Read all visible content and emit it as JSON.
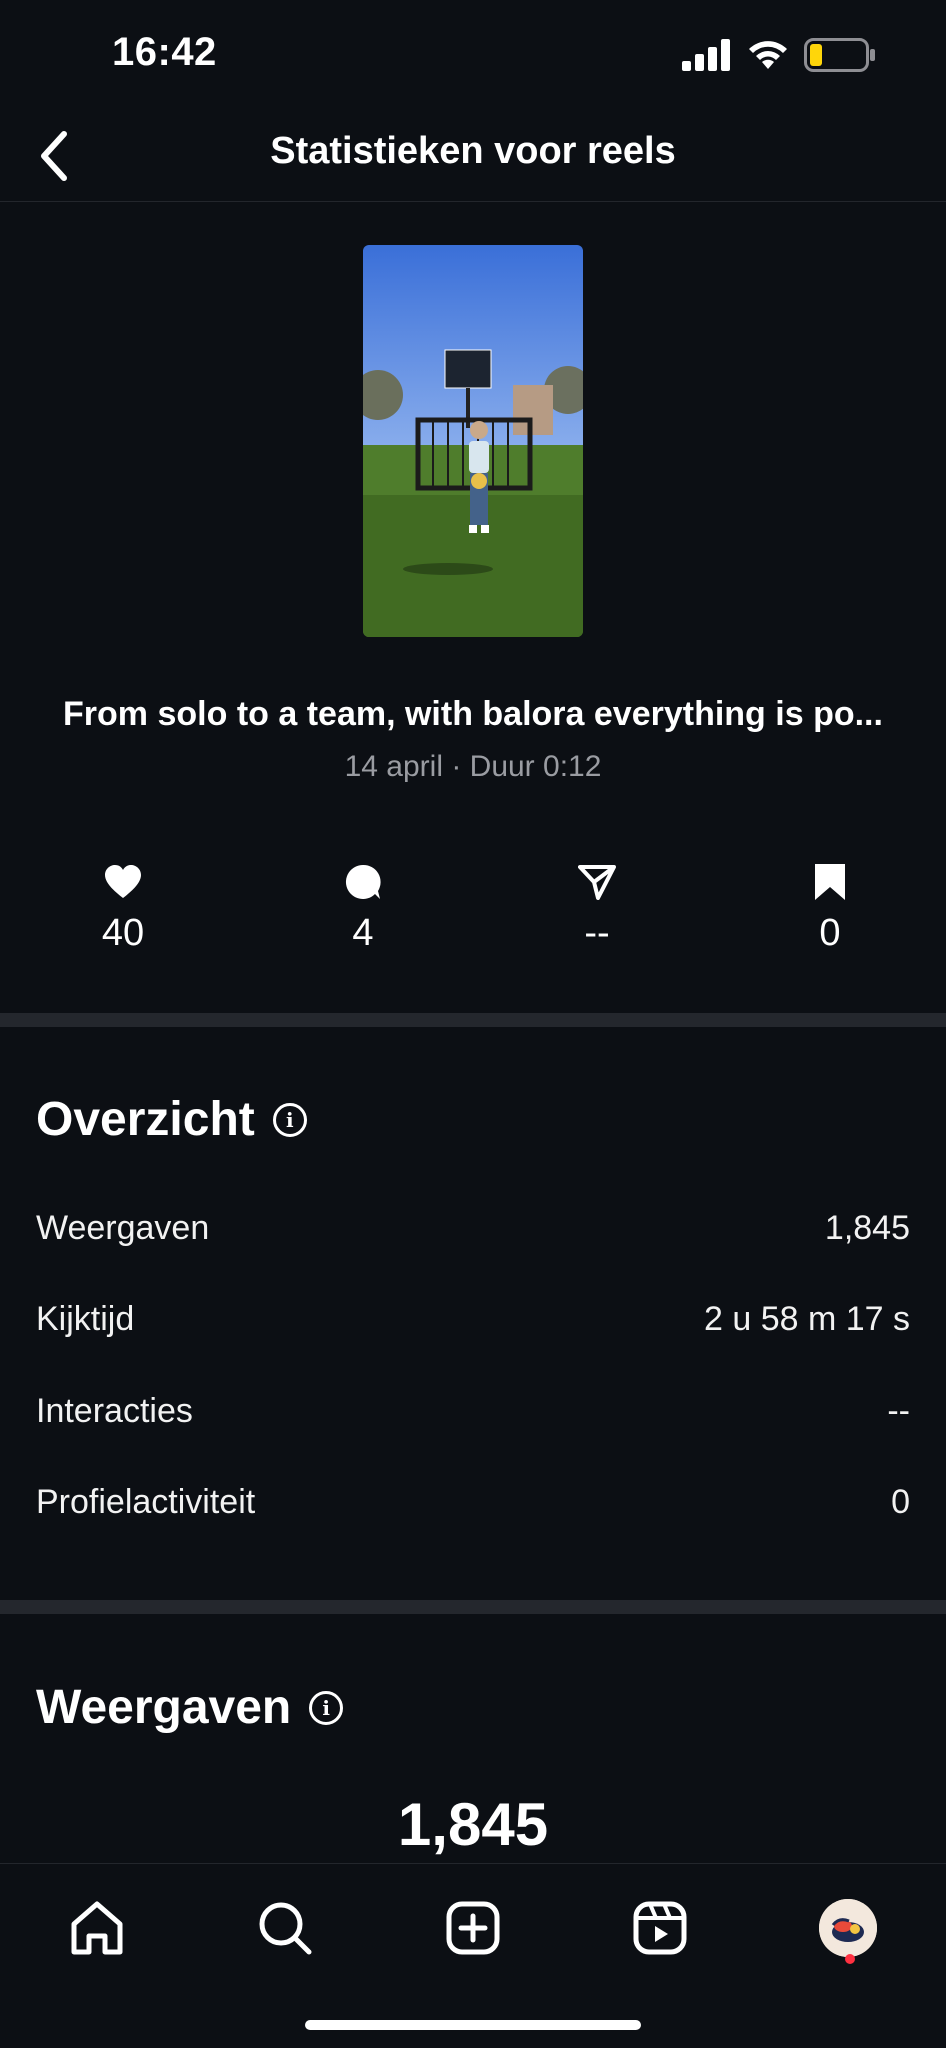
{
  "status_bar": {
    "time": "16:42",
    "battery_color": "#ffd60a"
  },
  "header": {
    "title": "Statistieken voor reels"
  },
  "reel": {
    "caption": "From solo to a team, with balora everything is po...",
    "meta": "14 april · Duur 0:12"
  },
  "stats": {
    "likes": "40",
    "comments": "4",
    "shares": "--",
    "saves": "0"
  },
  "overview": {
    "title": "Overzicht",
    "rows": [
      {
        "label": "Weergaven",
        "value": "1,845"
      },
      {
        "label": "Kijktijd",
        "value": "2 u 58 m 17 s"
      },
      {
        "label": "Interacties",
        "value": "--"
      },
      {
        "label": "Profielactiviteit",
        "value": "0"
      }
    ]
  },
  "views": {
    "title": "Weergaven",
    "total": "1,845"
  },
  "nav": {
    "items": [
      "home-icon",
      "search-icon",
      "create-icon",
      "reels-icon",
      "profile-avatar"
    ],
    "notification_color": "#ff3040"
  }
}
